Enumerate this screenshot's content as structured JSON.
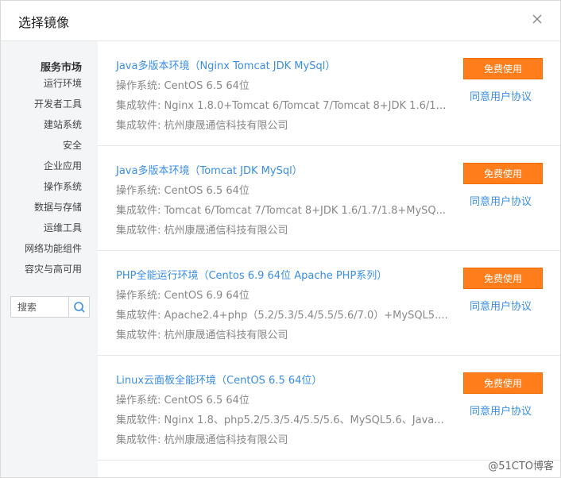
{
  "dialog": {
    "title": "选择镜像"
  },
  "sidebar": {
    "category_title": "服务市场",
    "items": [
      {
        "label": "运行环境"
      },
      {
        "label": "开发者工具"
      },
      {
        "label": "建站系统"
      },
      {
        "label": "安全"
      },
      {
        "label": "企业应用"
      },
      {
        "label": "操作系统"
      },
      {
        "label": "数据与存储"
      },
      {
        "label": "运维工具"
      },
      {
        "label": "网络功能组件"
      },
      {
        "label": "容灾与高可用"
      }
    ],
    "search": {
      "placeholder": "搜索"
    }
  },
  "images": [
    {
      "name": "Java多版本环境（Nginx Tomcat JDK MySql）",
      "os_label": "操作系统: ",
      "os": "CentOS 6.5 64位",
      "software_label": "集成软件: ",
      "software": "Nginx 1.8.0+Tomcat 6/Tomcat 7/Tomcat 8+JDK 1.6/1....",
      "vendor_label": "集成软件: ",
      "vendor": "杭州康晟通信科技有限公司",
      "button": "免费使用",
      "agreement": "同意用户协议"
    },
    {
      "name": "Java多版本环境（Tomcat JDK MySql）",
      "os_label": "操作系统: ",
      "os": "CentOS 6.5 64位",
      "software_label": "集成软件: ",
      "software": "Tomcat 6/Tomcat 7/Tomcat 8+JDK 1.6/1.7/1.8+MySQ...",
      "vendor_label": "集成软件: ",
      "vendor": "杭州康晟通信科技有限公司",
      "button": "免费使用",
      "agreement": "同意用户协议"
    },
    {
      "name": "PHP全能运行环境（Centos 6.9 64位 Apache PHP系列）",
      "os_label": "操作系统: ",
      "os": "CentOS 6.9 64位",
      "software_label": "集成软件: ",
      "software": "Apache2.4+php（5.2/5.3/5.4/5.5/5.6/7.0）+MySQL5....",
      "vendor_label": "集成软件: ",
      "vendor": "杭州康晟通信科技有限公司",
      "button": "免费使用",
      "agreement": "同意用户协议"
    },
    {
      "name": "Linux云面板全能环境（CentOS 6.5 64位）",
      "os_label": "操作系统: ",
      "os": "CentOS 6.5 64位",
      "software_label": "集成软件: ",
      "software": "Nginx 1.8、php5.2/5.3/5.4/5.5/5.6、MySQL5.6、Java...",
      "vendor_label": "集成软件: ",
      "vendor": "杭州康晟通信科技有限公司",
      "button": "免费使用",
      "agreement": "同意用户协议"
    }
  ],
  "watermark": "@51CTO博客",
  "colors": {
    "accent": "#ff7d1a",
    "link": "#3a8ee6",
    "sidebar_bg": "#f4f5f7"
  }
}
